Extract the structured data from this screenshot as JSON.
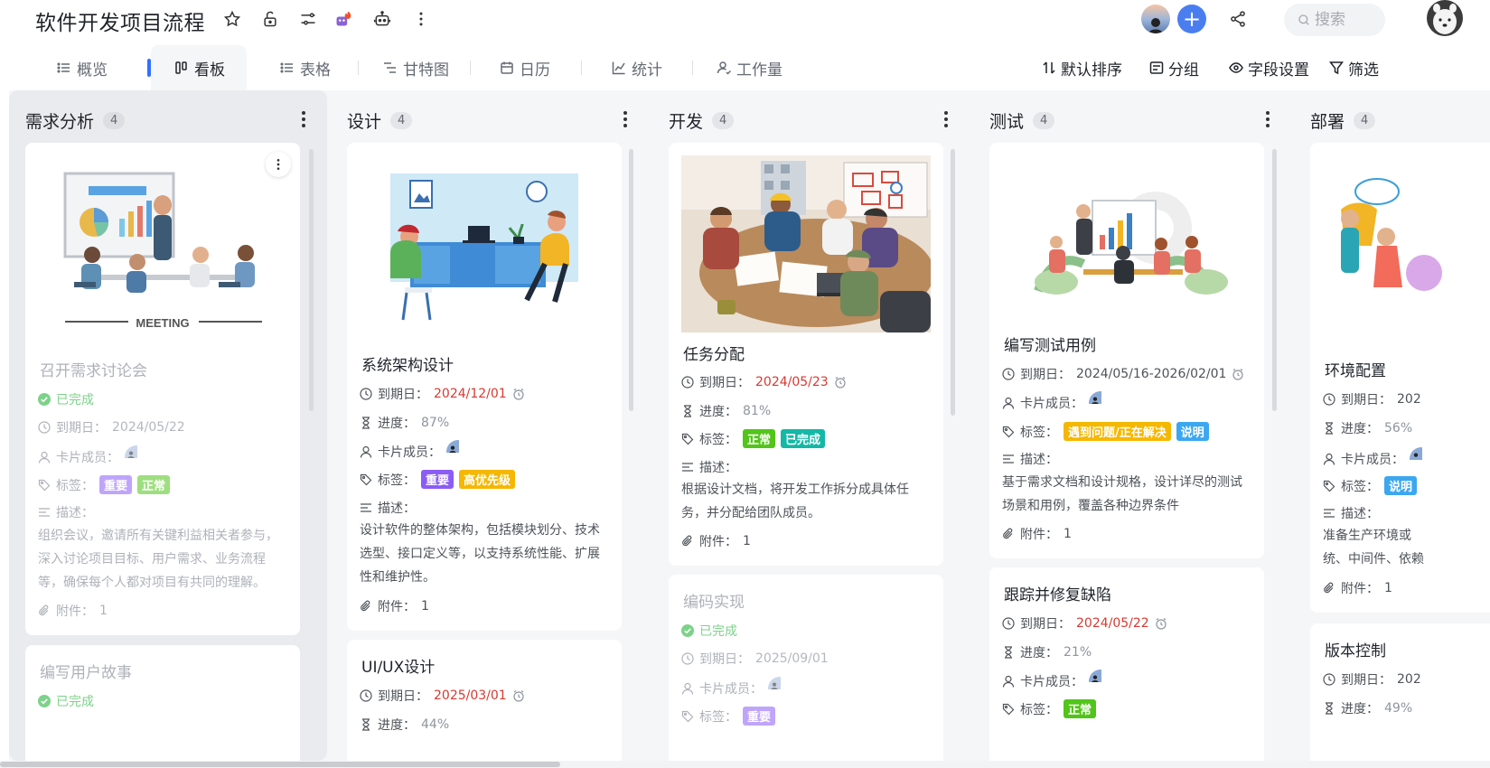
{
  "header": {
    "title": "软件开发项目流程",
    "search_placeholder": "搜索"
  },
  "tabs": [
    {
      "label": "概览",
      "icon": "list-icon"
    },
    {
      "label": "看板",
      "icon": "board-icon",
      "active": true
    },
    {
      "label": "表格",
      "icon": "table-icon"
    },
    {
      "label": "甘特图",
      "icon": "gantt-icon"
    },
    {
      "label": "日历",
      "icon": "calendar-icon"
    },
    {
      "label": "统计",
      "icon": "chart-icon"
    },
    {
      "label": "工作量",
      "icon": "workload-icon"
    }
  ],
  "tools": {
    "sort": "默认排序",
    "group": "分组",
    "fields": "字段设置",
    "filter": "筛选"
  },
  "labels": {
    "due": "到期日：",
    "progress": "进度：",
    "members": "卡片成员：",
    "tags": "标签：",
    "desc": "描述：",
    "attach": "附件：",
    "done": "已完成"
  },
  "columns": [
    {
      "title": "需求分析",
      "count": "4",
      "cards": [
        {
          "title": "召开需求讨论会",
          "status": "已完成",
          "due": "2024/05/22",
          "tags": [
            "重要",
            "正常"
          ],
          "desc": "组织会议，邀请所有关键利益相关者参与，深入讨论项目目标、用户需求、业务流程等，确保每个人都对项目有共同的理解。",
          "attach": "1"
        },
        {
          "title": "编写用户故事",
          "status": "已完成"
        }
      ]
    },
    {
      "title": "设计",
      "count": "4",
      "cards": [
        {
          "title": "系统架构设计",
          "due": "2024/12/01",
          "progress": "87%",
          "tags": [
            "重要",
            "高优先级"
          ],
          "desc": "设计软件的整体架构，包括模块划分、技术选型、接口定义等，以支持系统性能、扩展性和维护性。",
          "attach": "1"
        },
        {
          "title": "UI/UX设计",
          "due": "2025/03/01",
          "progress": "44%"
        }
      ]
    },
    {
      "title": "开发",
      "count": "4",
      "cards": [
        {
          "title": "任务分配",
          "due": "2024/05/23",
          "progress": "81%",
          "tags": [
            "正常",
            "已完成"
          ],
          "desc": "根据设计文档，将开发工作拆分成具体任务，并分配给团队成员。",
          "attach": "1"
        },
        {
          "title": "编码实现",
          "status": "已完成",
          "due": "2025/09/01",
          "tags": [
            "重要"
          ]
        }
      ]
    },
    {
      "title": "测试",
      "count": "4",
      "cards": [
        {
          "title": "编写测试用例",
          "due": "2024/05/16-2026/02/01",
          "tags": [
            "遇到问题/正在解决",
            "说明"
          ],
          "desc": "基于需求文档和设计规格，设计详尽的测试场景和用例，覆盖各种边界条件",
          "attach": "1"
        },
        {
          "title": "跟踪并修复缺陷",
          "due": "2024/05/22",
          "progress": "21%",
          "tags": [
            "正常"
          ]
        }
      ]
    },
    {
      "title": "部署",
      "count": "4",
      "cards": [
        {
          "title": "环境配置",
          "due": "202",
          "progress": "56%",
          "tags": [
            "说明"
          ],
          "desc1": "准备生产环境或",
          "desc2": "统、中间件、依赖",
          "attach": "1"
        },
        {
          "title": "版本控制",
          "due": "202",
          "progress": "49%"
        }
      ]
    }
  ],
  "tag_colors": {
    "重要": "#8b5cf6",
    "正常": "#52c41a",
    "高优先级": "#f5b700",
    "已完成": "#14b8a6",
    "遇到问题/正在解决": "#f5b700",
    "说明": "#3ba7f0"
  }
}
